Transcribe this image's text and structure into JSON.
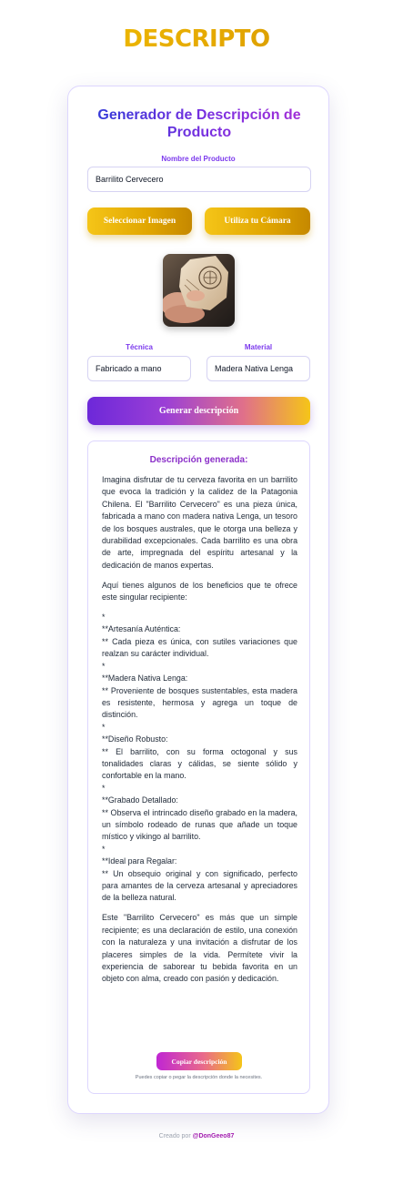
{
  "header": {
    "logo_text": "DESCRIPTO"
  },
  "form": {
    "title": "Generador de Descripción de Producto",
    "product_name_label": "Nombre del Producto",
    "product_name_value": "Barrilito Cervecero",
    "select_image_label": "Seleccionar Imagen",
    "use_camera_label": "Utiliza tu Cámara",
    "technique_label": "Técnica",
    "technique_value": "Fabricado a mano",
    "material_label": "Material",
    "material_value": "Madera Nativa Lenga",
    "generate_label": "Generar descripción"
  },
  "result": {
    "title": "Descripción generada:",
    "intro": "Imagina disfrutar de tu cerveza favorita en un barrilito que evoca la tradición y la calidez de la Patagonia Chilena. El \"Barrilito Cervecero\" es una pieza única, fabricada a mano con madera nativa Lenga, un tesoro de los bosques australes, que le otorga una belleza y durabilidad excepcionales. Cada barrilito es una obra de arte, impregnada del espíritu artesanal y la dedicación de manos expertas.",
    "benefits_intro": "Aquí tienes algunos de los beneficios que te ofrece este singular recipiente:",
    "benefits": [
      {
        "bullet": "*",
        "heading": "**Artesanía Auténtica:",
        "text": "** Cada pieza es única, con sutiles variaciones que realzan su carácter individual."
      },
      {
        "bullet": "*",
        "heading": "**Madera Nativa Lenga:",
        "text": "** Proveniente de bosques sustentables, esta madera es resistente, hermosa y agrega un toque de distinción."
      },
      {
        "bullet": "*",
        "heading": "**Diseño Robusto:",
        "text": "** El barrilito, con su forma octogonal y sus tonalidades claras y cálidas, se siente sólido y confortable en la mano."
      },
      {
        "bullet": "*",
        "heading": "**Grabado Detallado:",
        "text": "** Observa el intrincado diseño grabado en la madera, un símbolo rodeado de runas que añade un toque místico y vikingo al barrilito."
      },
      {
        "bullet": "*",
        "heading": "**Ideal para Regalar:",
        "text": "** Un obsequio original y con significado, perfecto para amantes de la cerveza artesanal y apreciadores de la belleza natural."
      }
    ],
    "closing": "Este \"Barrilito Cervecero\" es más que un simple recipiente; es una declaración de estilo, una conexión con la naturaleza y una invitación a disfrutar de los placeres simples de la vida. Permítete vivir la experiencia de saborear tu bebida favorita en un objeto con alma, creado con pasión y dedicación.",
    "copy_label": "Copiar descripción",
    "copy_hint": "Puedes copiar o pegar la descripción donde la necesites."
  },
  "footer": {
    "prefix": "Creado por",
    "handle": "@DonGeeo87"
  },
  "colors": {
    "accent_purple": "#7c3aed",
    "accent_yellow": "#f5c518",
    "title_blue": "#2f3bd8"
  }
}
